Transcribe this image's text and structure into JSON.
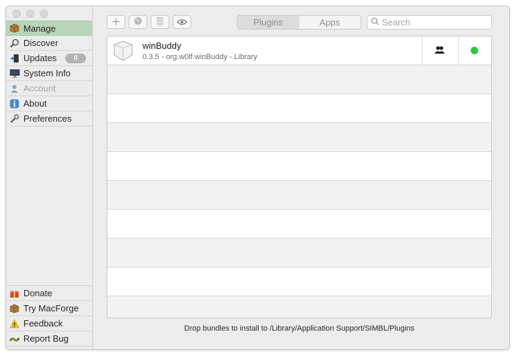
{
  "sidebar": {
    "items": [
      {
        "label": "Manage",
        "icon": "package-icon"
      },
      {
        "label": "Discover",
        "icon": "magnifier-icon"
      },
      {
        "label": "Updates",
        "icon": "download-icon",
        "badge": "0"
      },
      {
        "label": "System Info",
        "icon": "monitor-icon"
      },
      {
        "label": "Account",
        "icon": "user-icon"
      },
      {
        "label": "About",
        "icon": "info-icon"
      },
      {
        "label": "Preferences",
        "icon": "wrench-icon"
      }
    ],
    "bottom_items": [
      {
        "label": "Donate",
        "icon": "gift-icon"
      },
      {
        "label": "Try MacForge",
        "icon": "package-icon"
      },
      {
        "label": "Feedback",
        "icon": "warning-icon"
      },
      {
        "label": "Report Bug",
        "icon": "bug-icon"
      }
    ]
  },
  "toolbar": {
    "buttons": [
      "add-icon",
      "globe-icon",
      "trash-icon",
      "eye-icon"
    ],
    "segments": [
      "Plugins",
      "Apps"
    ],
    "selected_segment": "Plugins",
    "search_placeholder": "Search"
  },
  "plugins": [
    {
      "name": "winBuddy",
      "meta": "0.3.5 - org.w0lf.winBuddy - Library",
      "status": "enabled",
      "status_color": "#2cc640"
    }
  ],
  "footer": {
    "drop_hint": "Drop bundles to install to /Library/Application Support/SIMBL/Plugins"
  },
  "colors": {
    "selected_sidebar": "#b9d5b8",
    "status_enabled": "#2cc640"
  }
}
